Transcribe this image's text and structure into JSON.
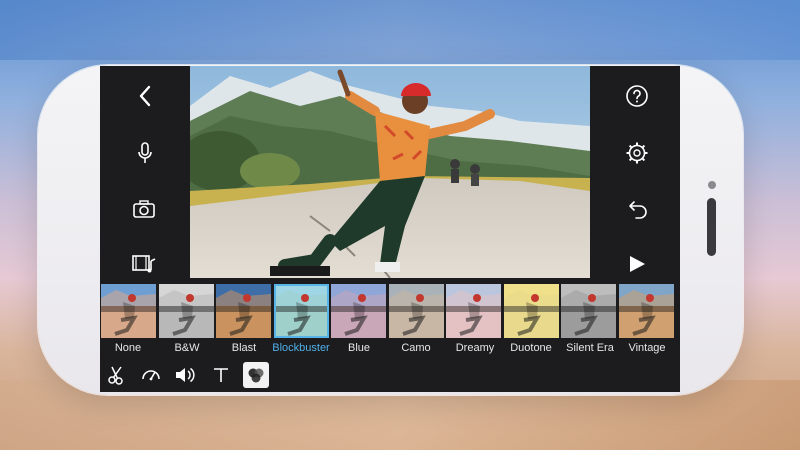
{
  "filters": [
    {
      "label": "None",
      "tint": "#d8a88a",
      "sky": "#6f9fd2"
    },
    {
      "label": "B&W",
      "tint": "#b8b8b8",
      "sky": "#d6d6d6"
    },
    {
      "label": "Blast",
      "tint": "#c9925e",
      "sky": "#3e6ea8"
    },
    {
      "label": "Blockbuster",
      "tint": "#9fd0c9",
      "sky": "#9fd6e6"
    },
    {
      "label": "Blue",
      "tint": "#c9a6b8",
      "sky": "#8ea6d8"
    },
    {
      "label": "Camo",
      "tint": "#c8b7a4",
      "sky": "#a8b2b8"
    },
    {
      "label": "Dreamy",
      "tint": "#e4c2c4",
      "sky": "#b9c6de"
    },
    {
      "label": "Duotone",
      "tint": "#e8d98c",
      "sky": "#f0e08a"
    },
    {
      "label": "Silent Era",
      "tint": "#9c9c9c",
      "sky": "#bdbdbd"
    },
    {
      "label": "Vintage",
      "tint": "#d0a070",
      "sky": "#7fa5c8"
    }
  ],
  "selected_filter": "Blockbuster",
  "left_controls": [
    "back-icon",
    "microphone-icon",
    "camera-icon",
    "video-music-icon"
  ],
  "right_controls": [
    "help-icon",
    "settings-icon",
    "undo-icon",
    "play-icon"
  ],
  "toolbar": [
    "scissors-icon",
    "speedometer-icon",
    "volume-icon",
    "text-icon",
    "filters-icon"
  ],
  "colors": {
    "accent": "#4fb0ea",
    "screen_bg": "#1c1c1e"
  }
}
